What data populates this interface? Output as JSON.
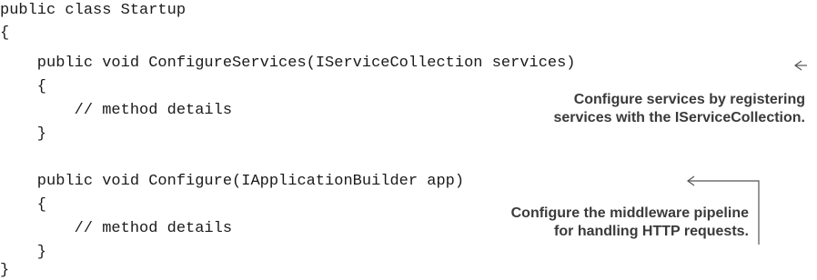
{
  "code": {
    "lines": [
      "public class Startup",
      "{",
      "    public void ConfigureServices(IServiceCollection services)",
      "    {",
      "        // method details",
      "    }",
      "",
      "    public void Configure(IApplicationBuilder app)",
      "    {",
      "        // method details",
      "    }",
      "}"
    ]
  },
  "annotations": {
    "configure_services": {
      "line1": "Configure services by registering",
      "line2": "services with the IServiceCollection."
    },
    "configure": {
      "line1": "Configure the middleware pipeline",
      "line2": "for handling HTTP requests."
    }
  },
  "colors": {
    "code_text": "#1a1a1a",
    "annotation_text": "#3a3a3a",
    "callout_line": "#555555"
  }
}
